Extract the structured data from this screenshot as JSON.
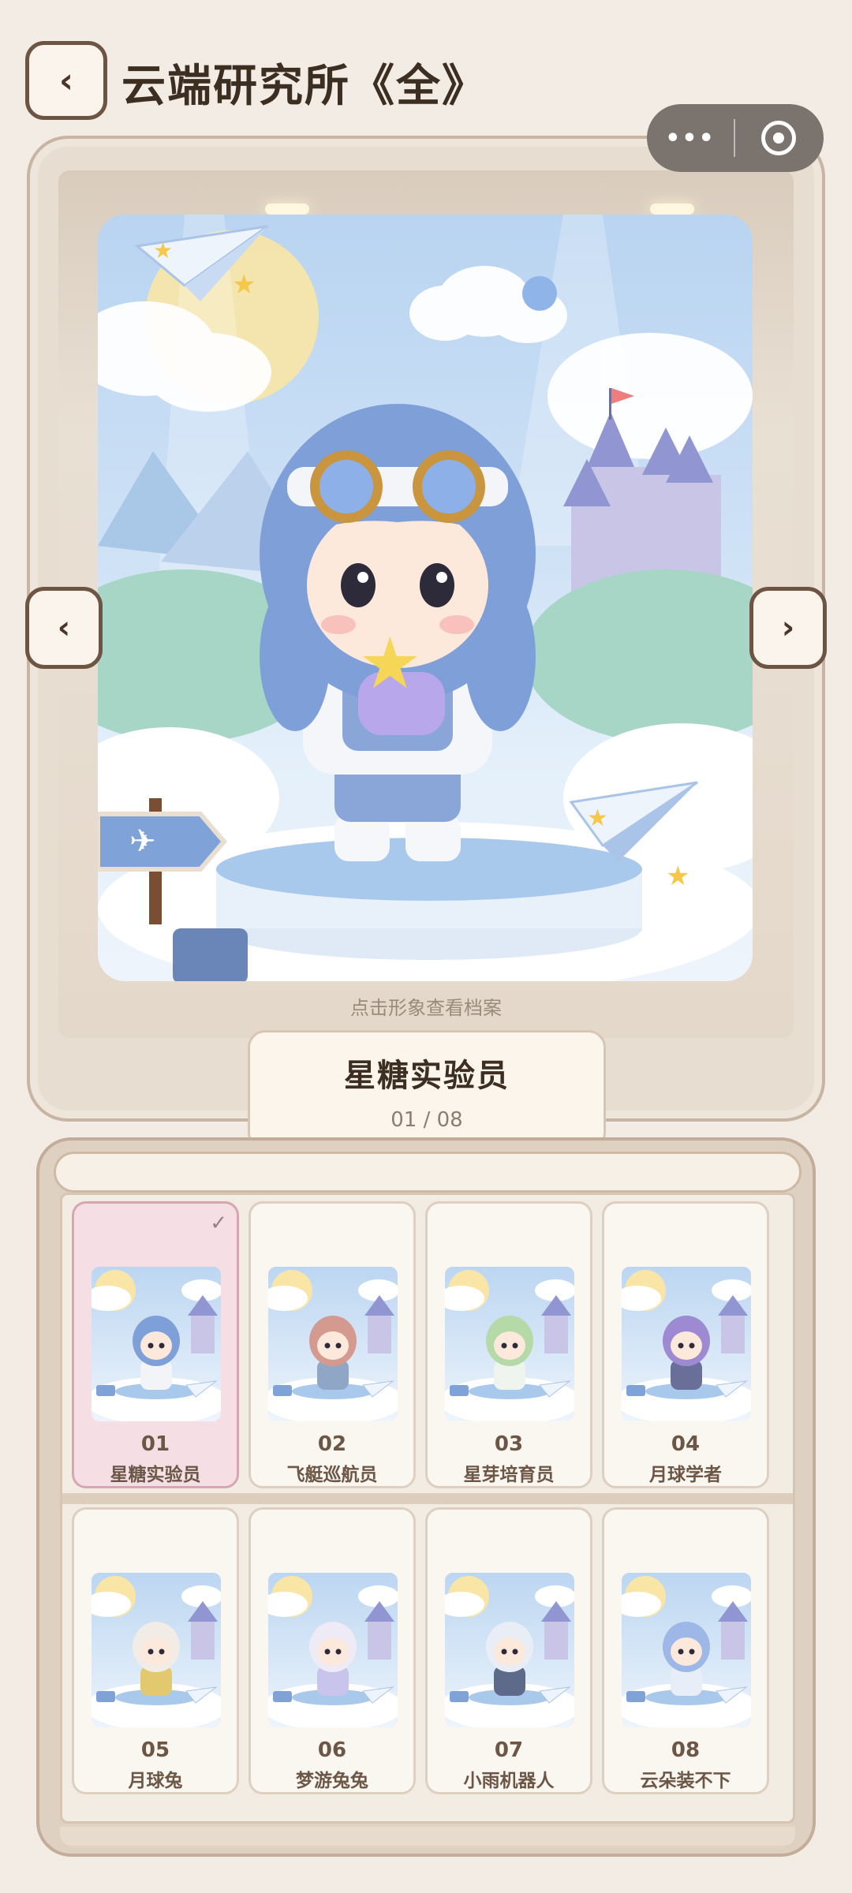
{
  "header": {
    "back_icon": "‹",
    "title": "云端研究所《全》",
    "capsule_more": "•••"
  },
  "showcase": {
    "prev_icon": "‹",
    "next_icon": "›",
    "caption": "点击形象查看档案",
    "current_name": "星糖实验员",
    "counter": "01 / 08"
  },
  "grid": {
    "selected_mark": "✓",
    "items": [
      {
        "num": "01",
        "name": "星糖实验员",
        "hair": "#7f9fd8",
        "outfit": "#f2f4f8",
        "selected": true
      },
      {
        "num": "02",
        "name": "飞艇巡航员",
        "hair": "#d59a8f",
        "outfit": "#8fa6c7",
        "selected": false
      },
      {
        "num": "03",
        "name": "星芽培育员",
        "hair": "#b6d9a8",
        "outfit": "#f0f4ee",
        "selected": false
      },
      {
        "num": "04",
        "name": "月球学者",
        "hair": "#9d8ad2",
        "outfit": "#6a6f9a",
        "selected": false
      },
      {
        "num": "05",
        "name": "月球兔",
        "hair": "#f1ece6",
        "outfit": "#e2c86e",
        "selected": false
      },
      {
        "num": "06",
        "name": "梦游兔兔",
        "hair": "#eeeaf6",
        "outfit": "#c9c4ec",
        "selected": false
      },
      {
        "num": "07",
        "name": "小雨机器人",
        "hair": "#e9eef6",
        "outfit": "#5d6a8a",
        "selected": false
      },
      {
        "num": "08",
        "name": "云朵装不下",
        "hair": "#9db8e6",
        "outfit": "#e7eef8",
        "selected": false
      }
    ]
  },
  "colors": {
    "frame": "#e7ddd1",
    "border_dark": "#6d5443",
    "selected_card": "#f5dee4",
    "sky": "#b9d4f1"
  }
}
